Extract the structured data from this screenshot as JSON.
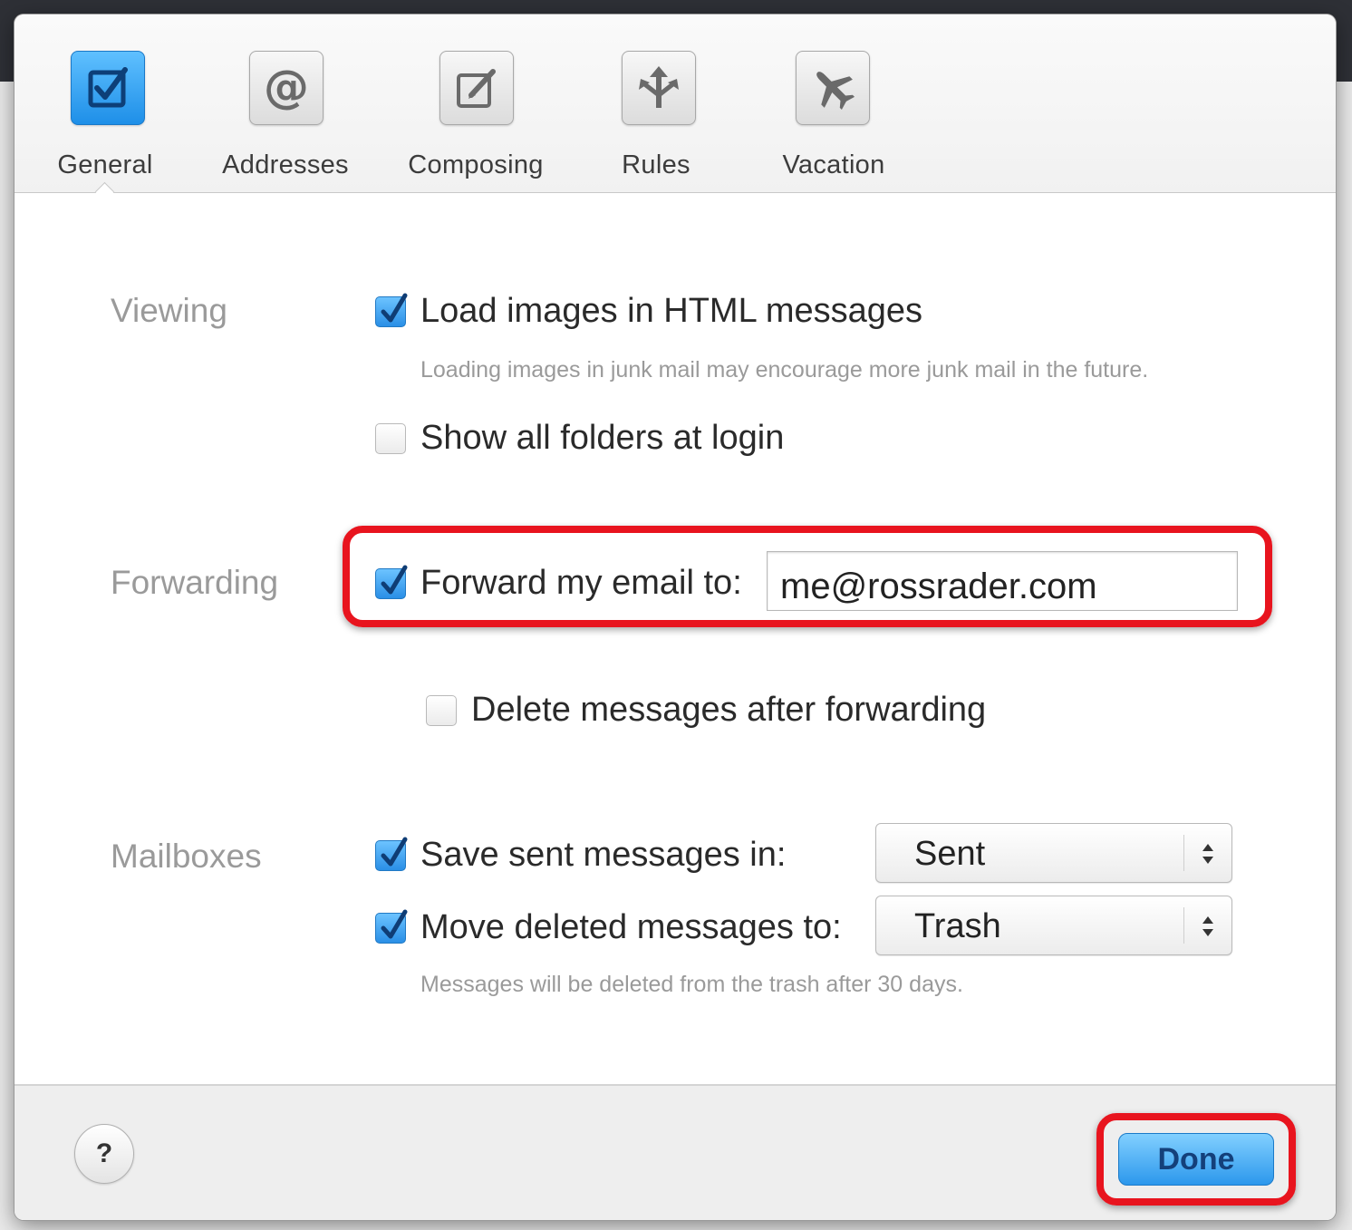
{
  "tabs": [
    {
      "label": "General",
      "icon": "checkbox-icon",
      "active": true
    },
    {
      "label": "Addresses",
      "icon": "at-sign-icon",
      "active": false
    },
    {
      "label": "Composing",
      "icon": "compose-icon",
      "active": false
    },
    {
      "label": "Rules",
      "icon": "rules-icon",
      "active": false
    },
    {
      "label": "Vacation",
      "icon": "airplane-icon",
      "active": false
    }
  ],
  "viewing": {
    "section_label": "Viewing",
    "load_images": {
      "label": "Load images in HTML messages",
      "checked": true
    },
    "load_images_hint": "Loading images in junk mail may encourage more junk mail in the future.",
    "show_folders": {
      "label": "Show all folders at login",
      "checked": false
    }
  },
  "forwarding": {
    "section_label": "Forwarding",
    "forward": {
      "label": "Forward my email to:",
      "checked": true
    },
    "address": "me@rossrader.com",
    "delete_after": {
      "label": "Delete messages after forwarding",
      "checked": false
    }
  },
  "mailboxes": {
    "section_label": "Mailboxes",
    "save_sent": {
      "label": "Save sent messages in:",
      "checked": true,
      "selected": "Sent"
    },
    "move_deleted": {
      "label": "Move deleted messages to:",
      "checked": true,
      "selected": "Trash"
    },
    "hint": "Messages will be deleted from the trash after 30 days."
  },
  "footer": {
    "help_label": "?",
    "done_label": "Done"
  },
  "colors": {
    "accent": "#2a8fe6",
    "highlight": "#e8141e"
  }
}
